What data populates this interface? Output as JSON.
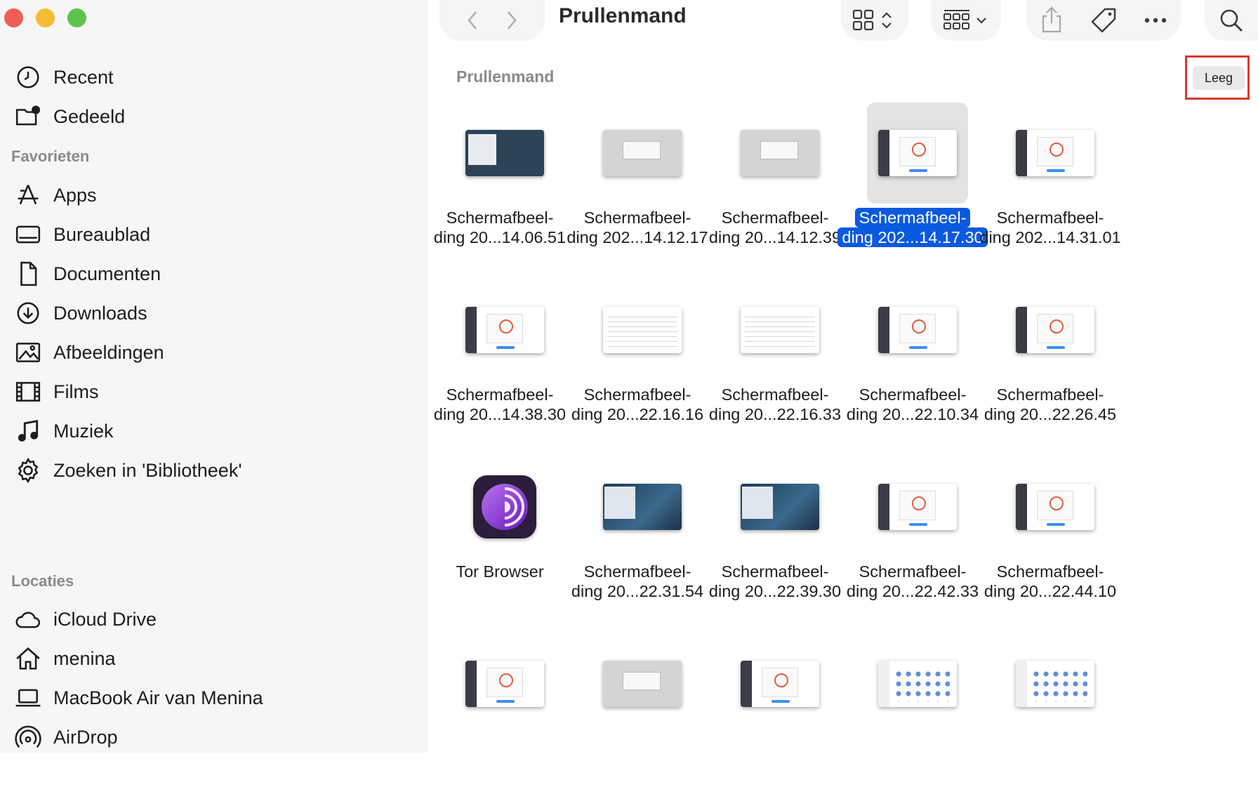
{
  "window": {
    "title": "Prullenmand"
  },
  "sidebar": {
    "top_items": [
      {
        "label": "Recent",
        "icon": "clock-icon"
      },
      {
        "label": "Gedeeld",
        "icon": "shared-folder-icon"
      }
    ],
    "favorites_heading": "Favorieten",
    "favorites": [
      {
        "label": "Apps",
        "icon": "apps-icon"
      },
      {
        "label": "Bureaublad",
        "icon": "desktop-icon"
      },
      {
        "label": "Documenten",
        "icon": "document-icon"
      },
      {
        "label": "Downloads",
        "icon": "download-icon"
      },
      {
        "label": "Afbeeldingen",
        "icon": "photo-icon"
      },
      {
        "label": "Films",
        "icon": "film-icon"
      },
      {
        "label": "Muziek",
        "icon": "music-icon"
      },
      {
        "label": "Zoeken in 'Bibliotheek'",
        "icon": "gear-icon"
      }
    ],
    "locations_heading": "Locaties",
    "locations": [
      {
        "label": "iCloud Drive",
        "icon": "cloud-icon"
      },
      {
        "label": "menina",
        "icon": "home-icon"
      },
      {
        "label": "MacBook Air van Menina",
        "icon": "laptop-icon"
      },
      {
        "label": "AirDrop",
        "icon": "airdrop-icon"
      }
    ]
  },
  "main": {
    "path_heading": "Prullenmand",
    "empty_button": "Leeg",
    "files": [
      {
        "line1": "Schermafbeel-",
        "line2": "ding 20...14.06.51",
        "kind": "dark",
        "selected": false
      },
      {
        "line1": "Schermafbeel-",
        "line2": "ding 202...14.12.17",
        "kind": "gray",
        "selected": false
      },
      {
        "line1": "Schermafbeel-",
        "line2": "ding 20...14.12.39",
        "kind": "gray",
        "selected": false
      },
      {
        "line1": "Schermafbeel-",
        "line2": "ding 202...14.17.30",
        "kind": "app",
        "selected": true
      },
      {
        "line1": "Schermafbeel-",
        "line2": "ding 202...14.31.01",
        "kind": "app",
        "selected": false
      },
      {
        "line1": "Schermafbeel-",
        "line2": "ding 20...14.38.30",
        "kind": "app",
        "selected": false
      },
      {
        "line1": "Schermafbeel-",
        "line2": "ding 20...22.16.16",
        "kind": "doc",
        "selected": false
      },
      {
        "line1": "Schermafbeel-",
        "line2": "ding 20...22.16.33",
        "kind": "doc",
        "selected": false
      },
      {
        "line1": "Schermafbeel-",
        "line2": "ding 20...22.10.34",
        "kind": "app",
        "selected": false
      },
      {
        "line1": "Schermafbeel-",
        "line2": "ding 20...22.26.45",
        "kind": "app",
        "selected": false
      },
      {
        "line1": "Tor Browser",
        "line2": "",
        "kind": "tor",
        "selected": false
      },
      {
        "line1": "Schermafbeel-",
        "line2": "ding 20...22.31.54",
        "kind": "sky",
        "selected": false
      },
      {
        "line1": "Schermafbeel-",
        "line2": "ding 20...22.39.30",
        "kind": "sky",
        "selected": false
      },
      {
        "line1": "Schermafbeel-",
        "line2": "ding 20...22.42.33",
        "kind": "app",
        "selected": false
      },
      {
        "line1": "Schermafbeel-",
        "line2": "ding 20...22.44.10",
        "kind": "app",
        "selected": false
      },
      {
        "line1": "",
        "line2": "",
        "kind": "app",
        "selected": false
      },
      {
        "line1": "",
        "line2": "",
        "kind": "gray",
        "selected": false
      },
      {
        "line1": "",
        "line2": "",
        "kind": "app",
        "selected": false
      },
      {
        "line1": "",
        "line2": "",
        "kind": "icons",
        "selected": false
      },
      {
        "line1": "",
        "line2": "",
        "kind": "icons",
        "selected": false
      }
    ]
  },
  "colors": {
    "selection": "#0a5ae0",
    "highlight_box": "#d93a2b",
    "sidebar_bg": "#f6f6f6"
  }
}
